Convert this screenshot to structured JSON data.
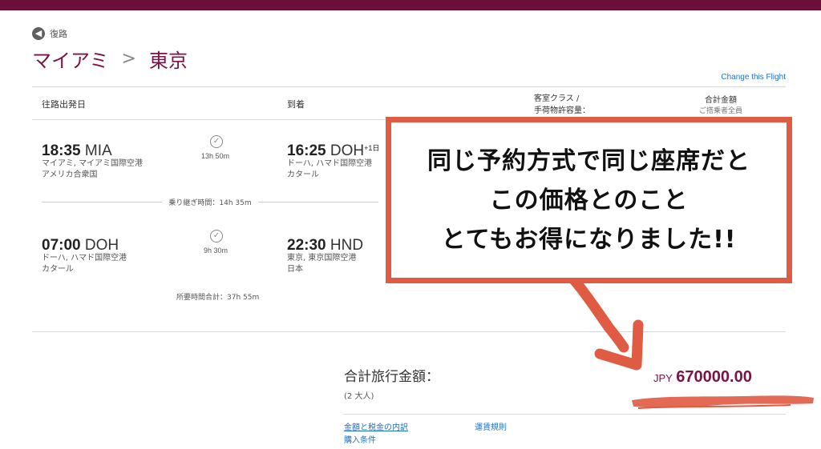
{
  "header": {
    "back_label": "復路",
    "origin": "マイアミ",
    "destination": "東京",
    "change_link": "Change this Flight"
  },
  "table_header": {
    "departure": "往路出発日",
    "arrival": "到着",
    "cabin_line1": "客室クラス /",
    "cabin_line2": "手荷物許容量：",
    "total": "合計金額",
    "total_sub": "ご搭乗者全員"
  },
  "segments": [
    {
      "dep_time": "18:35",
      "dep_code": "MIA",
      "dep_place": "マイアミ, マイアミ国際空港",
      "dep_country": "アメリカ合衆国",
      "duration": "13h 50m",
      "arr_time": "16:25",
      "arr_code": "DOH",
      "arr_plus": "+1日",
      "arr_place": "ドーハ, ハマド国際空港",
      "arr_country": "カタール"
    },
    {
      "dep_time": "07:00",
      "dep_code": "DOH",
      "dep_place": "ドーハ, ハマド国際空港",
      "dep_country": "カタール",
      "duration": "9h 30m",
      "arr_time": "22:30",
      "arr_code": "HND",
      "arr_plus": "",
      "arr_place": "東京, 東京国際空港",
      "arr_country": "日本"
    }
  ],
  "layover": "乗り継ぎ時間：14h 35m",
  "total_duration": "所要時間合計：37h 55m",
  "summary": {
    "label": "合計旅行金額：",
    "passengers": "(2 大人)",
    "currency": "JPY",
    "amount": "670000.00"
  },
  "links": {
    "fare_breakdown": "金額と税金の内訳",
    "fare_rules": "運賃規則",
    "purchase_terms": "購入条件"
  },
  "callout": {
    "line1": "同じ予約方式で同じ座席だと",
    "line2": "この価格とのこと",
    "line3": "とてもお得になりました!!"
  },
  "colors": {
    "brand": "#6b0f3a",
    "accent": "#7a1347",
    "link": "#1f72c4",
    "callout_border": "#e05b44"
  }
}
